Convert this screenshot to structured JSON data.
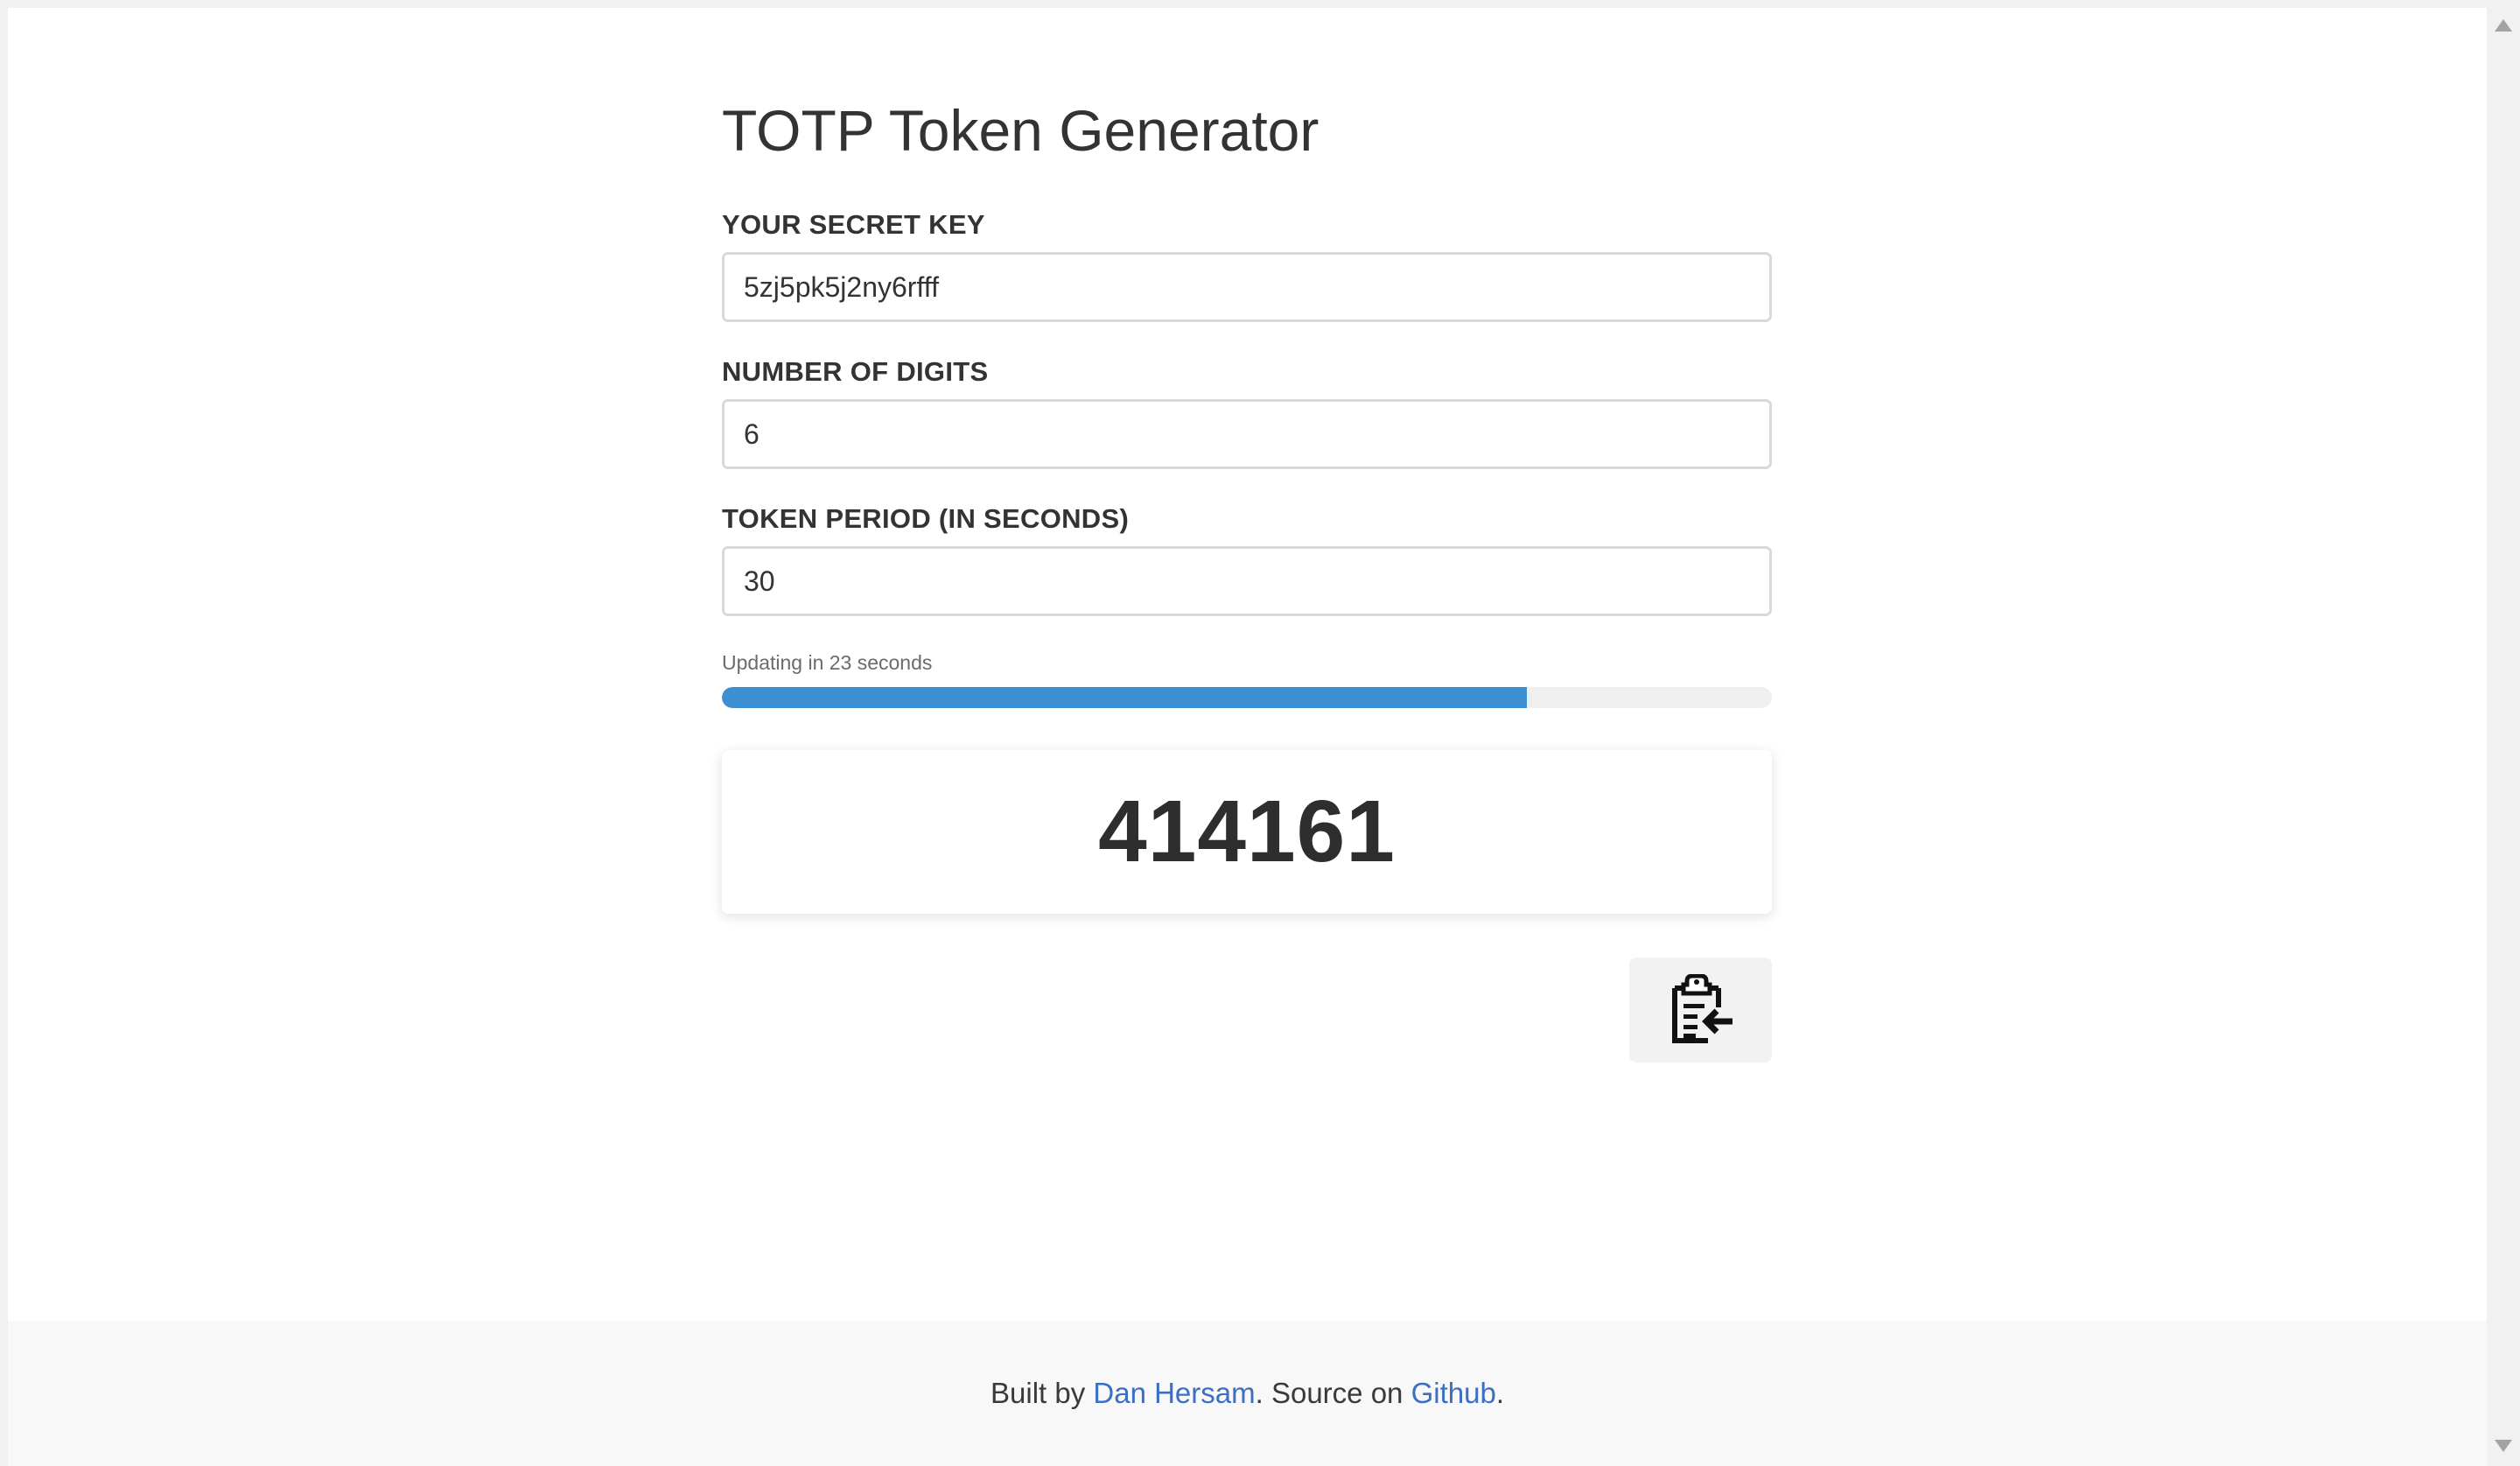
{
  "page": {
    "title": "TOTP Token Generator"
  },
  "form": {
    "secret_label": "YOUR SECRET KEY",
    "secret_value": "5zj5pk5j2ny6rfff",
    "digits_label": "NUMBER OF DIGITS",
    "digits_value": "6",
    "period_label": "TOKEN PERIOD (IN SECONDS)",
    "period_value": "30"
  },
  "progress": {
    "label": "Updating in 23 seconds",
    "percent": 76.7,
    "color": "#3c8fd3"
  },
  "token": {
    "value": "414161"
  },
  "copy_button": {
    "icon": "clipboard-copy-icon"
  },
  "footer": {
    "prefix": "Built by ",
    "author": "Dan Hersam",
    "middle": ". Source on ",
    "source": "Github",
    "suffix": "."
  }
}
